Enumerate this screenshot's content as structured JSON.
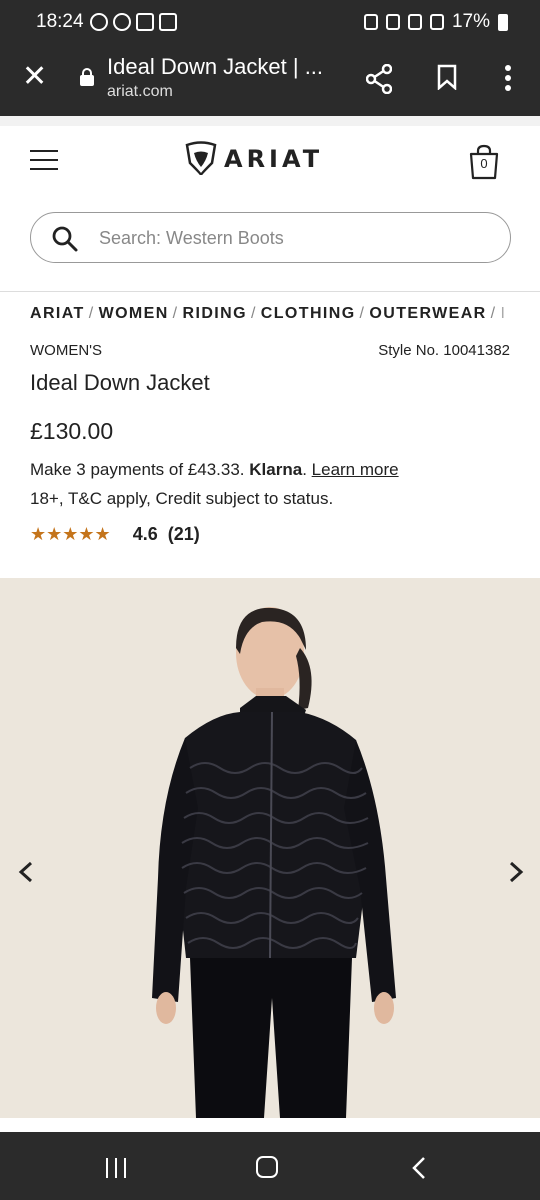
{
  "status_bar": {
    "time": "18:24",
    "battery": "17%"
  },
  "browser": {
    "title": "Ideal Down Jacket | ...",
    "domain": "ariat.com"
  },
  "header": {
    "logo_text": "ARIAT",
    "bag_count": "0"
  },
  "search": {
    "placeholder": "Search: Western Boots"
  },
  "breadcrumb": [
    "ARIAT",
    "WOMEN",
    "RIDING",
    "CLOTHING",
    "OUTERWEAR",
    "I"
  ],
  "product": {
    "category": "WOMEN'S",
    "style_no": "Style No. 10041382",
    "title": "Ideal Down Jacket",
    "price": "£130.00",
    "klarna_prefix": "Make 3 payments of £43.33.",
    "klarna_brand": "Klarna",
    "klarna_dot": ".",
    "klarna_link": "Learn more",
    "terms": "18+, T&C apply, Credit subject to status.",
    "stars": "★★★★★",
    "rating": "4.6",
    "review_count": "(21)",
    "rating_value": 4.6
  },
  "colors": {
    "system_bar": "#2b2b2b",
    "star": "#c4741b",
    "image_bg": "#ece6dc"
  }
}
